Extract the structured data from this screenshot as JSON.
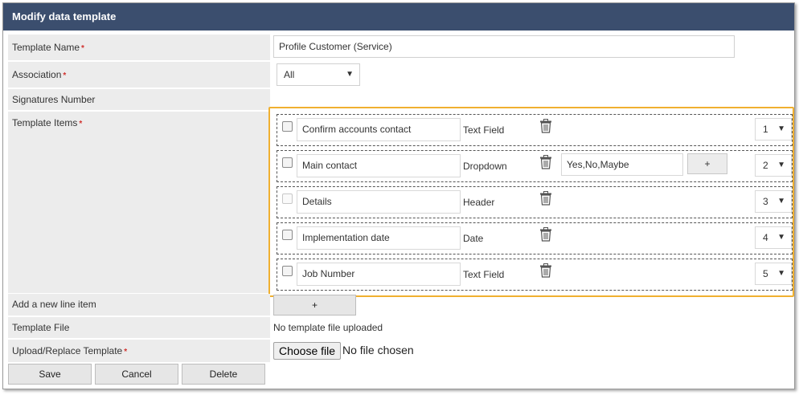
{
  "title": "Modify data template",
  "form": {
    "template_name_label": "Template Name",
    "template_name_value": "Profile Customer (Service)",
    "association_label": "Association",
    "association_value": "All",
    "signatures_label": "Signatures Number",
    "template_items_label": "Template Items",
    "add_line_label": "Add a new line item",
    "add_line_button": "+",
    "template_file_label": "Template File",
    "template_file_value": "No template file uploaded",
    "upload_label": "Upload/Replace Template",
    "choose_file_button": "Choose file",
    "no_file_text": "No file chosen",
    "required_mark": "*"
  },
  "items": [
    {
      "name": "Confirm accounts contact",
      "type": "Text Field",
      "order": "1",
      "checkbox_enabled": true
    },
    {
      "name": "Main contact",
      "type": "Dropdown",
      "options": "Yes,No,Maybe",
      "add_option": "+",
      "order": "2",
      "checkbox_enabled": true
    },
    {
      "name": "Details",
      "type": "Header",
      "order": "3",
      "checkbox_enabled": false
    },
    {
      "name": "Implementation date",
      "type": "Date",
      "order": "4",
      "checkbox_enabled": true
    },
    {
      "name": "Job Number",
      "type": "Text Field",
      "order": "5",
      "checkbox_enabled": true
    }
  ],
  "actions": {
    "save": "Save",
    "cancel": "Cancel",
    "delete": "Delete"
  },
  "icons": {
    "trash": "trash-icon",
    "caret": "chevron-down-icon"
  },
  "colors": {
    "header_bg": "#3b4e6e",
    "label_bg": "#ececec",
    "highlight": "#f0b030",
    "required": "#d0312d"
  }
}
